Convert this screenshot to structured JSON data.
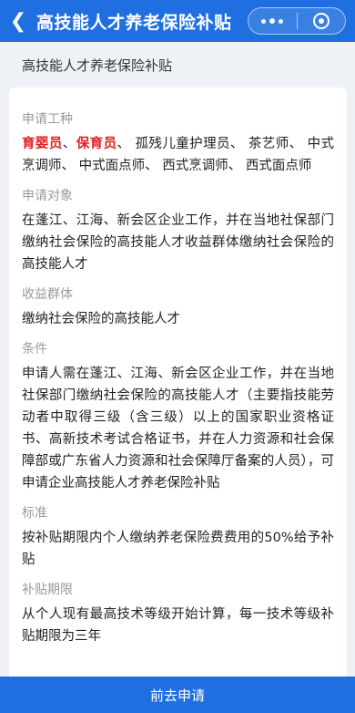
{
  "header": {
    "back_icon": "chevron-left-icon",
    "title": "高技能人才养老保险补贴",
    "more_icon": "more-dots-icon",
    "close_icon": "target-circle-icon",
    "brand_color": "#1f6fe0"
  },
  "sub_title": "高技能人才养老保险补贴",
  "sections": {
    "work_type": {
      "label": "申请工种",
      "highlight_1": "育婴员",
      "sep_1": "、",
      "highlight_2": "保育员",
      "rest": "、 孤残儿童护理员、 茶艺师、 中式烹调师、 中式面点师、 西式烹调师、 西式面点师"
    },
    "applicant": {
      "label": "申请对象",
      "value": "在蓬江、江海、新会区企业工作，并在当地社保部门缴纳社会保险的高技能人才收益群体缴纳社会保险的高技能人才"
    },
    "beneficiary": {
      "label": "收益群体",
      "value": "缴纳社会保险的高技能人才"
    },
    "conditions": {
      "label": "条件",
      "value": "申请人需在蓬江、江海、新会区企业工作，并在当地社保部门缴纳社会保险的高技能人才（主要指技能劳动者中取得三级（含三级）以上的国家职业资格证书、高新技术考试合格证书，并在人力资源和社会保障部或广东省人力资源和社会保障厅备案的人员），可申请企业高技能人才养老保险补贴"
    },
    "standard": {
      "label": "标准",
      "value": "按补贴期限内个人缴纳养老保险费费用的50%给予补贴"
    },
    "period": {
      "label": "补贴期限",
      "value": "从个人现有最高技术等级开始计算，每一技术等级补贴期限为三年"
    }
  },
  "footer": {
    "apply_label": "前去申请"
  }
}
